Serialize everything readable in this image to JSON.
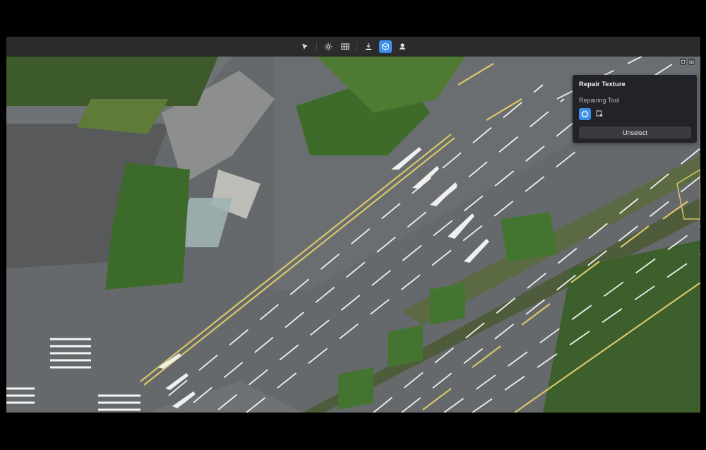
{
  "toolbar": {
    "groups": [
      [
        "select-tool"
      ],
      [
        "lighting-tool",
        "mesh-tool"
      ],
      [
        "flatten-tool",
        "repair-texture-tool",
        "model-tool"
      ]
    ],
    "active_tool": "repair-texture-tool"
  },
  "repair_panel": {
    "title": "Repair Texture",
    "subtitle": "Repairing Tool",
    "tools": [
      "chip-icon",
      "select-area-icon"
    ],
    "active_tool": "chip-icon",
    "unselect_label": "Unselect"
  },
  "colors": {
    "accent": "#3a8ee8",
    "panel_bg": "#222326",
    "toolbar_bg": "#2b2b2b",
    "road": "#6f7275",
    "lane_yellow": "#d8c56a",
    "lane_white": "#f0f0f0",
    "vegetation": "#3f6b2a"
  }
}
